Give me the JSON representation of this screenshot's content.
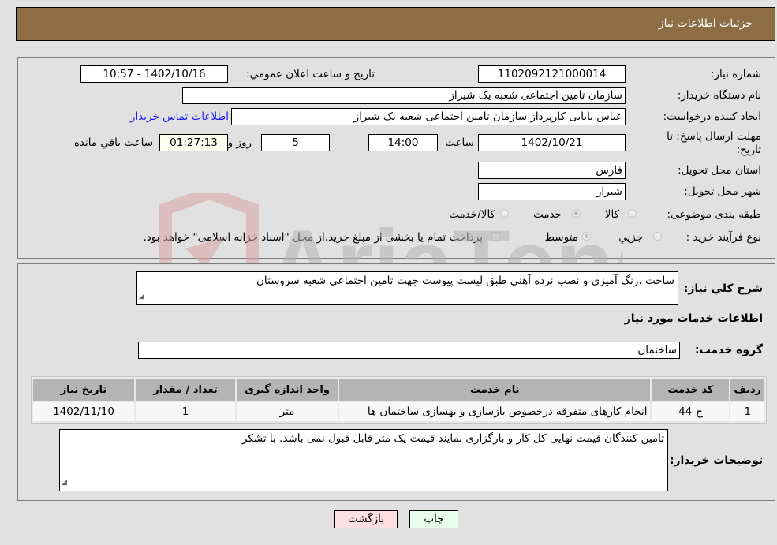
{
  "header": {
    "title": "جزئیات اطلاعات نیاز"
  },
  "info": {
    "need_number": {
      "label": "شماره نیاز:",
      "value": "1102092121000014"
    },
    "announce_datetime": {
      "label": "تاریخ و ساعت اعلان عمومي:",
      "value": "1402/10/16 - 10:57"
    },
    "buyer_org": {
      "label": "نام دستگاه خریدار:",
      "value": "سازمان تامین اجتماعی شعبه یک شیراز"
    },
    "requester": {
      "label": "ایجاد کننده درخواست:",
      "value": "عباس  بابایی  کارپرداز  سازمان تامین اجتماعی شعبه یک شیراز"
    },
    "contact_link": "اطلاعات تماس خریدار",
    "deadline": {
      "label": "مهلت ارسال پاسخ: تا تاریخ:",
      "date": "1402/10/21",
      "time_label": "ساعت",
      "time": "14:00",
      "days": "5",
      "days_label": "روز و",
      "remaining": "01:27:13",
      "remaining_label": "ساعت باقي مانده"
    },
    "province": {
      "label": "استان محل تحویل:",
      "value": "فارس"
    },
    "city": {
      "label": "شهر محل تحویل:",
      "value": "شیراز"
    },
    "category": {
      "label": "طبقه بندی موضوعی:",
      "options": [
        "کالا",
        "خدمت",
        "کالا/خدمت"
      ],
      "selected": "خدمت"
    },
    "purchase_type": {
      "label": "نوع فرآیند خرید :",
      "options": [
        "جزيي",
        "متوسط"
      ],
      "selected": "متوسط",
      "treasury_note": "پرداخت تمام یا بخشی از مبلغ خرید،از محل \"اسناد خزانه اسلامی\" خواهد بود."
    }
  },
  "description": {
    "label": "شرح كلي نياز:",
    "value": "ساخت .رنگ آمیزی و نصب نرده آهنی طبق لیست پیوست جهت تامین اجتماعی شعبه سروستان"
  },
  "services": {
    "section_title": "اطلاعات خدمات مورد نياز",
    "group_label": "گروه خدمت:",
    "group_value": "ساختمان",
    "table": {
      "headers": [
        "ردیف",
        "کد خدمت",
        "نام خدمت",
        "واحد اندازه گیری",
        "تعداد / مقدار",
        "تاریخ نیاز"
      ],
      "rows": [
        [
          "1",
          "ج-44",
          "انجام کارهای متفرقه درخصوص بازسازی و بهسازی ساختمان ها",
          "متر",
          "1",
          "1402/11/10"
        ]
      ]
    }
  },
  "buyer_notes": {
    "label": "توضیحات خریدار:",
    "value": "تامین کنندگان قیمت نهایی کل کار و بارگزاری نمایند قیمت یک متر قابل قبول نمی باشد. با تشکر"
  },
  "buttons": {
    "print": "چاپ",
    "back": "بازگشت"
  },
  "watermark": {
    "text": "AriaTender.neT",
    "colors": {
      "shield": "#d9a3a3",
      "text": "#b5b5b5"
    }
  }
}
